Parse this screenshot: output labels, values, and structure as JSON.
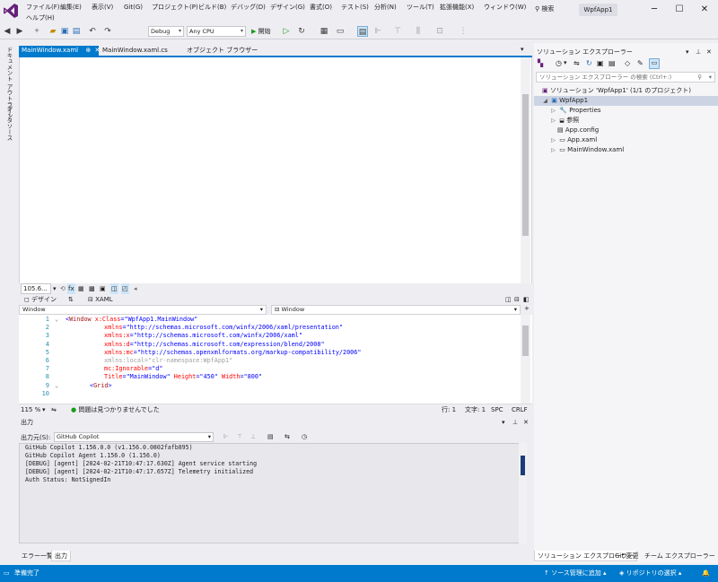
{
  "menu": {
    "items": [
      "ファイル(F)",
      "編集(E)",
      "表示(V)",
      "Git(G)",
      "プロジェクト(P)",
      "ビルド(B)",
      "デバッグ(D)",
      "デザイン(G)",
      "書式(O)",
      "テスト(S)",
      "分析(N)",
      "ツール(T)",
      "拡張機能(X)",
      "ウィンドウ(W)"
    ],
    "help": "ヘルプ(H)",
    "search": "検索",
    "app_title": "WpfApp1"
  },
  "toolbar": {
    "config": "Debug",
    "platform": "Any CPU",
    "start": "開始"
  },
  "left_strip": {
    "tab1": "ドキュメント アウトライン",
    "tab2": "データソース"
  },
  "doc_tabs": [
    {
      "label": "MainWindow.xaml",
      "pin": "⊕",
      "close": "✕"
    },
    {
      "label": "MainWindow.xaml.cs"
    },
    {
      "label": "オブジェクト ブラウザー"
    }
  ],
  "designer": {
    "zoom": "105.6...",
    "design_tab": "デザイン",
    "swap": "⇅",
    "xaml_tab": "XAML",
    "scope_left": "Window",
    "scope_right": "Window"
  },
  "xaml": {
    "line_numbers": [
      "1",
      "2",
      "3",
      "4",
      "5",
      "6",
      "7",
      "8",
      "9",
      "10"
    ],
    "l1_tag": "Window",
    "l1_attr": "x:Class",
    "l1_val": "\"WpfApp1.MainWindow\"",
    "l2_attr": "xmlns",
    "l2_val": "\"http://schemas.microsoft.com/winfx/2006/xaml/presentation\"",
    "l3_attr": "xmlns:x",
    "l3_val": "\"http://schemas.microsoft.com/winfx/2006/xaml\"",
    "l4_attr": "xmlns:d",
    "l4_val": "\"http://schemas.microsoft.com/expression/blend/2008\"",
    "l5_attr": "xmlns:mc",
    "l5_val": "\"http://schemas.openxmlformats.org/markup-compatibility/2006\"",
    "l6_text": "xmlns:local=\"clr-namespace:WpfApp1\"",
    "l7_attr": "mc:Ignorable",
    "l7_val": "\"d\"",
    "l8_attr1": "Title",
    "l8_val1": "\"MainWindow\"",
    "l8_attr2": "Height",
    "l8_val2": "\"450\"",
    "l8_attr3": "Width",
    "l8_val3": "\"800\"",
    "l9_tag": "Grid"
  },
  "editor_status": {
    "zoom": "115 %",
    "issues": "問題は見つかりませんでした",
    "line": "行: 1",
    "col": "文字: 1",
    "spc": "SPC",
    "eol": "CRLF"
  },
  "output": {
    "title": "出力",
    "source_label": "出力元(S):",
    "source_value": "GitHub Copilot",
    "lines": [
      "GitHub Copilot 1.156.0.0 (v1.156.0.0802fafb895)",
      "GitHub Copilot Agent 1.156.0 (1.156.0)",
      "[DEBUG] [agent] [2024-02-21T10:47:17.630Z] Agent service starting",
      "[DEBUG] [agent] [2024-02-21T10:47:17.657Z] Telemetry initialized",
      "Auth Status: NotSignedIn"
    ]
  },
  "bottom_tabs": [
    "エラー一覧",
    "出力"
  ],
  "solution_explorer": {
    "title": "ソリューション エクスプローラー",
    "search_placeholder": "ソリューション エクスプローラー の検索 (Ctrl+:)",
    "solution": "ソリューション 'WpfApp1' (1/1 のプロジェクト)",
    "project": "WpfApp1",
    "items": [
      "Properties",
      "参照",
      "App.config",
      "App.xaml",
      "MainWindow.xaml"
    ],
    "bottom_tabs": [
      "ソリューション エクスプローラー",
      "Git 変更",
      "チーム エクスプローラー"
    ]
  },
  "statusbar": {
    "ready": "準備完了",
    "source_control": "ソース管理に追加",
    "repository": "リポジトリの選択"
  },
  "colors": {
    "accent": "#007acc",
    "vs_purple": "#68217a"
  }
}
